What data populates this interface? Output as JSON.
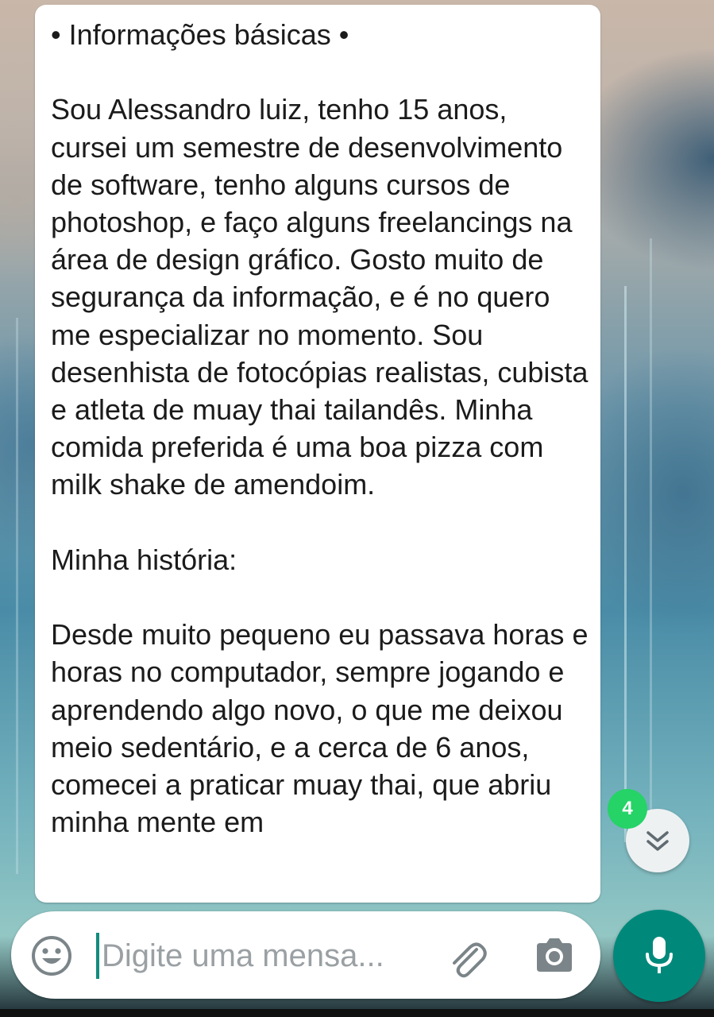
{
  "message": {
    "text": "• Informações básicas •\n\n  Sou Alessandro luiz, tenho 15 anos, cursei um semestre de desenvolvimento de software, tenho alguns cursos de photoshop, e faço alguns freelancings na área de design gráfico. Gosto muito de segurança da informação, e é no quero me especializar no momento. Sou desenhista de fotocópias realistas, cubista e atleta de muay thai tailandês. Minha comida preferida é uma boa pizza com milk shake de amendoim.\n\nMinha história:\n\n  Desde muito pequeno eu passava horas e horas no computador, sempre jogando e aprendendo algo novo, o que me deixou meio sedentário, e a cerca de 6 anos, comecei a praticar muay thai, que abriu minha mente em"
  },
  "scroll_to_bottom": {
    "unread_count": "4",
    "icon": "double-chevron-down-icon"
  },
  "composer": {
    "placeholder": "Digite uma mensa...",
    "value": "",
    "icons": [
      "emoji-icon",
      "attach-icon",
      "camera-icon",
      "mic-icon"
    ]
  },
  "colors": {
    "accent": "#00897b",
    "badge": "#25d366",
    "caret": "#128c7e"
  }
}
